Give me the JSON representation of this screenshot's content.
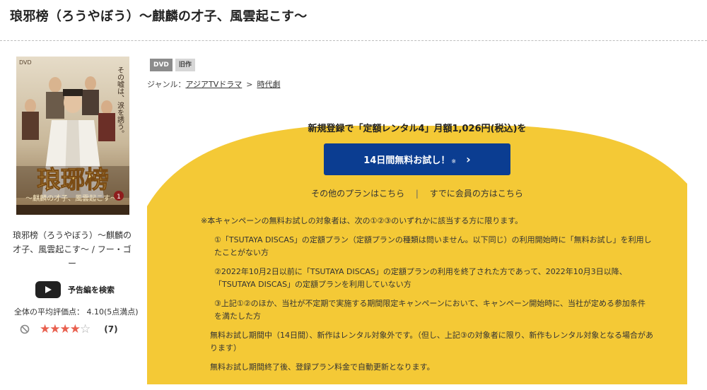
{
  "page": {
    "title": "琅邪榜（ろうやぼう）〜麒麟の才子、風雲起こす〜"
  },
  "cover": {
    "format_label": "DVD",
    "main_title": "琅琊榜",
    "subtitle": "〜麒麟の才子、風雲起こす〜",
    "catch_copy": "その嘘は、涙を誘う。",
    "volume": "1"
  },
  "work": {
    "title_cast": "琅邪榜（ろうやぼう）〜麒麟の才子、風雲起こす〜 / フー・ゴー"
  },
  "trailer": {
    "label": "予告編を検索",
    "icon": "play-icon"
  },
  "rating": {
    "text": "全体の平均評価点： 4.10(5点満点)",
    "value": 4.1,
    "max": 5,
    "count_label": "(7)",
    "accent": "#e9604f"
  },
  "tags": [
    {
      "label": "DVD"
    },
    {
      "label": "旧作"
    }
  ],
  "genre": {
    "prefix": "ジャンル：",
    "first": "アジアTVドラマ",
    "separator": ">",
    "second": "時代劇"
  },
  "promo": {
    "headline": "新規登録で「定額レンタル4」月額1,026円(税込)を",
    "cta_label": "14日間無料お試し！",
    "cta_mark": "※",
    "other_plans": "その他のプランはこちら",
    "divider": "|",
    "member_login": "すでに会員の方はこちら",
    "button_color": "#0b3d91",
    "band_color": "#f4c936"
  },
  "notes": {
    "heading": "※本キャンペーンの無料お試しの対象者は、次の①②③のいずれかに該当する方に限ります。",
    "items": [
      "①「TSUTAYA DISCAS」の定額プラン（定額プランの種類は問いません。以下同じ）の利用開始時に「無料お試し」を利用したことがない方",
      "②2022年10月2日以前に「TSUTAYA DISCAS」の定額プランの利用を終了された方であって、2022年10月3日以降、「TSUTAYA DISCAS」の定額プランを利用していない方",
      "③上記①②のほか、当社が不定期で実施する期間限定キャンペーンにおいて、キャンペーン開始時に、当社が定める参加条件を満たした方"
    ],
    "trial_period": "無料お試し期間中（14日間）、新作はレンタル対象外です。（但し、上記③の対象者に限り、新作もレンタル対象となる場合があります）",
    "auto_renew": "無料お試し期間終了後、登録プラン料金で自動更新となります。"
  }
}
